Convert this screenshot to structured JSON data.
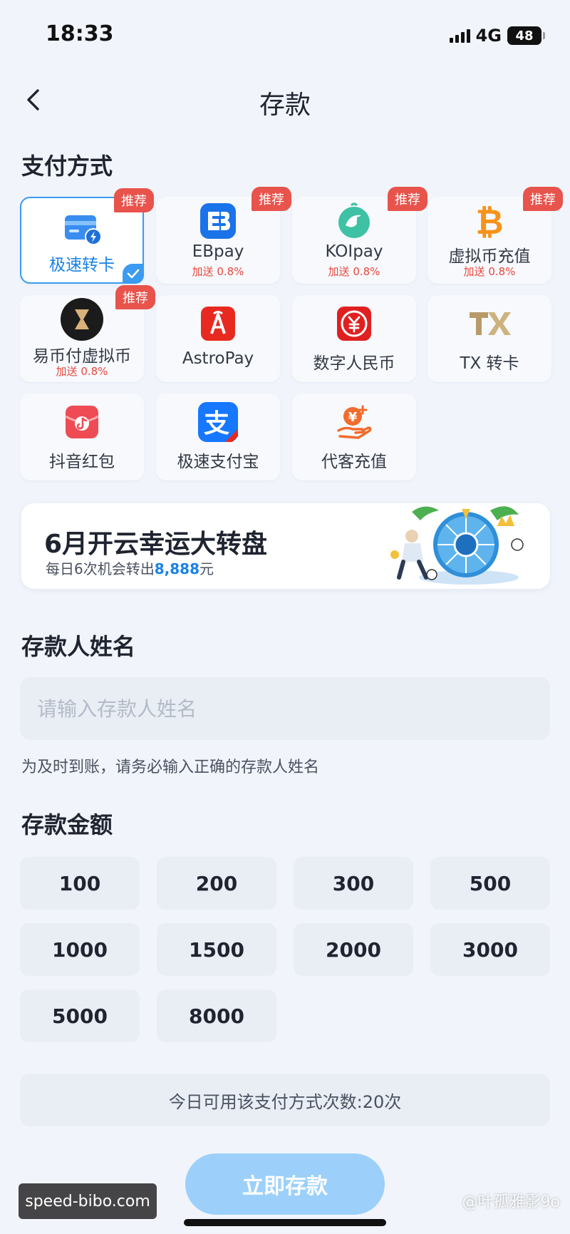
{
  "status": {
    "time": "18:33",
    "network": "4G",
    "battery": "48"
  },
  "nav": {
    "title": "存款"
  },
  "payment_section": {
    "title": "支付方式",
    "methods": [
      {
        "label": "极速转卡",
        "bonus": "",
        "badge": "推荐",
        "selected": true,
        "icon": "fast-card-icon"
      },
      {
        "label": "EBpay",
        "bonus": "加送 0.8%",
        "badge": "推荐",
        "icon": "ebpay-icon"
      },
      {
        "label": "KOIpay",
        "bonus": "加送 0.8%",
        "badge": "推荐",
        "icon": "koipay-icon"
      },
      {
        "label": "虚拟币充值",
        "bonus": "加送 0.8%",
        "badge": "推荐",
        "icon": "bitcoin-icon"
      },
      {
        "label": "易币付虚拟币",
        "bonus": "加送 0.8%",
        "badge": "推荐",
        "icon": "yibifu-icon"
      },
      {
        "label": "AstroPay",
        "bonus": "",
        "badge": "",
        "icon": "astropay-icon"
      },
      {
        "label": "数字人民币",
        "bonus": "",
        "badge": "",
        "icon": "digital-rmb-icon"
      },
      {
        "label": "TX 转卡",
        "bonus": "",
        "badge": "",
        "icon": "tx-logo-icon"
      },
      {
        "label": "抖音红包",
        "bonus": "",
        "badge": "",
        "icon": "douyin-redpacket-icon"
      },
      {
        "label": "极速支付宝",
        "bonus": "",
        "badge": "",
        "icon": "alipay-icon"
      },
      {
        "label": "代客充值",
        "bonus": "",
        "badge": "",
        "icon": "agent-recharge-icon"
      }
    ]
  },
  "banner": {
    "title": "6月开云幸运大转盘",
    "sub_prefix": "每日6次机会转出",
    "sub_amount": "8,888",
    "sub_suffix": "元"
  },
  "name_section": {
    "title": "存款人姓名",
    "placeholder": "请输入存款人姓名",
    "hint": "为及时到账，请务必输入正确的存款人姓名"
  },
  "amount_section": {
    "title": "存款金额",
    "amounts": [
      "100",
      "200",
      "300",
      "500",
      "1000",
      "1500",
      "2000",
      "3000",
      "5000",
      "8000"
    ]
  },
  "info": {
    "text": "今日可用该支付方式次数:20次"
  },
  "submit": {
    "label": "立即存款"
  },
  "watermarks": {
    "domain": "speed-bibo.com",
    "author": "@叶孤雅影9o"
  },
  "colors": {
    "accent": "#3a9bf0",
    "badge": "#e8534c",
    "bonus": "#e8473c",
    "submit": "#9cd0fa"
  }
}
